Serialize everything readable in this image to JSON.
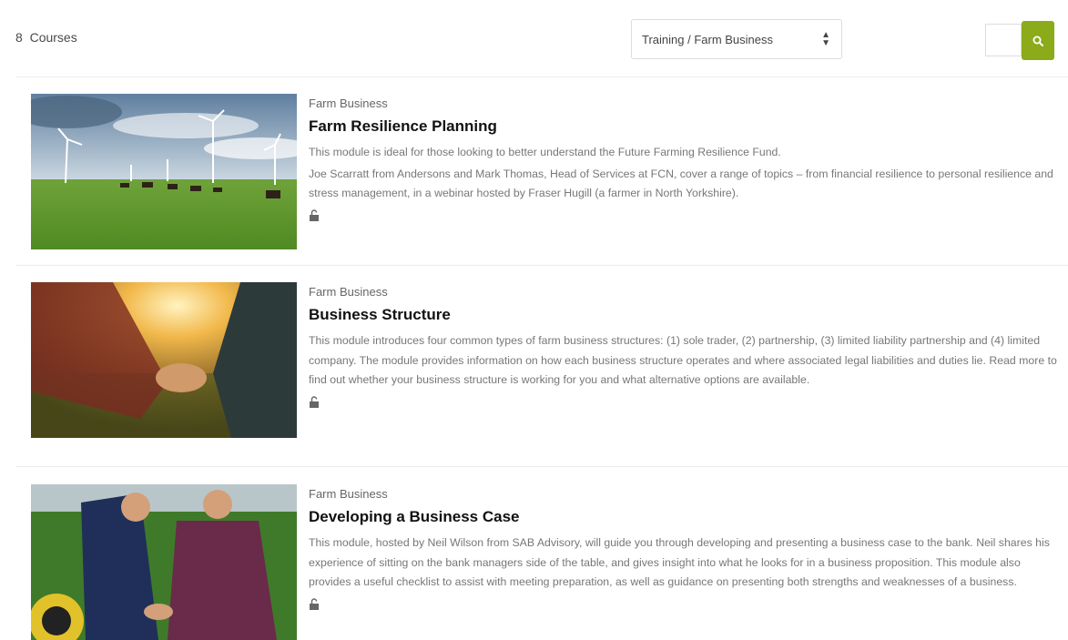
{
  "toolbar": {
    "course_count": "8",
    "course_count_label": "Courses",
    "category_select": "Training / Farm Business"
  },
  "colors": {
    "accent": "#8bab1b"
  },
  "courses": [
    {
      "category": "Farm Business",
      "title": "Farm Resilience Planning",
      "desc1": "This module is ideal for those looking to better understand the Future Farming Resilience Fund.",
      "desc2": "Joe Scarratt from Andersons and Mark Thomas, Head of Services at FCN, cover a range of topics – from financial resilience to personal resilience and stress management, in a webinar hosted by Fraser Hugill (a farmer in North Yorkshire).",
      "image": "wind-turbines-cattle-field"
    },
    {
      "category": "Farm Business",
      "title": "Business Structure",
      "desc1": "This module introduces four common types of farm business structures: (1) sole trader, (2) partnership, (3) limited liability partnership and (4) limited company. The module provides information on how each business structure operates and where associated legal liabilities and duties lie. Read more to find out whether your business structure is working for you and what alternative options are available.",
      "image": "handshake-sunset-field"
    },
    {
      "category": "Farm Business",
      "title": "Developing a Business Case",
      "desc1": "This module, hosted by Neil Wilson from SAB Advisory, will guide you through developing and presenting a business case to the bank. Neil shares his experience of sitting on the bank managers side of the table, and gives insight into what he looks for in a business proposition. This module also provides a useful checklist to assist with meeting preparation, as well as guidance on presenting both strengths and weaknesses of a business.",
      "image": "businessman-farmer-tractor-handshake"
    }
  ]
}
